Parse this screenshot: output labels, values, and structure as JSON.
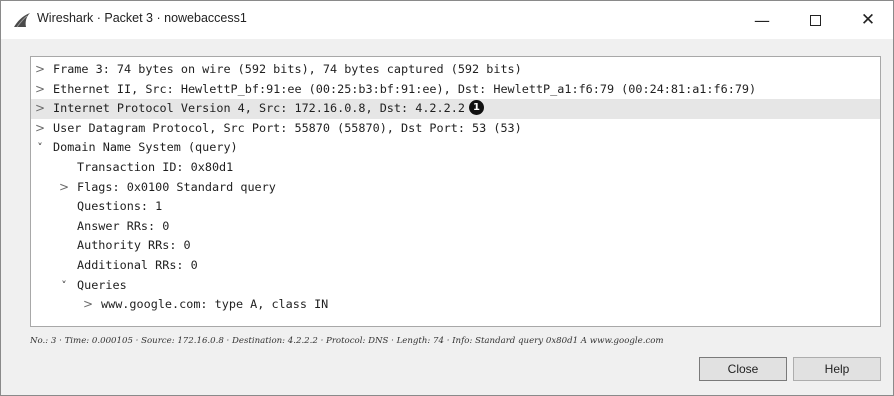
{
  "window": {
    "title": "Wireshark · Packet 3 · nowebaccess1",
    "minimize_glyph": "—",
    "close_glyph": "✕"
  },
  "tree": {
    "rows": [
      {
        "text": "Frame 3: 74 bytes on wire (592 bits), 74 bytes captured (592 bits)",
        "expander": ">"
      },
      {
        "text": "Ethernet II, Src: HewlettP_bf:91:ee (00:25:b3:bf:91:ee), Dst: HewlettP_a1:f6:79 (00:24:81:a1:f6:79)",
        "expander": ">"
      },
      {
        "text": "Internet Protocol Version 4, Src: 172.16.0.8, Dst: 4.2.2.2",
        "expander": ">",
        "callout": "1"
      },
      {
        "text": "User Datagram Protocol, Src Port: 55870 (55870), Dst Port: 53 (53)",
        "expander": ">"
      },
      {
        "text": "Domain Name System (query)",
        "expander": "˅"
      },
      {
        "text": "Transaction ID: 0x80d1"
      },
      {
        "text": "Flags: 0x0100 Standard query",
        "expander": ">"
      },
      {
        "text": "Questions: 1"
      },
      {
        "text": "Answer RRs: 0"
      },
      {
        "text": "Authority RRs: 0"
      },
      {
        "text": "Additional RRs: 0"
      },
      {
        "text": "Queries",
        "expander": "˅"
      },
      {
        "text": "www.google.com: type A, class IN",
        "expander": ">"
      }
    ]
  },
  "status": {
    "text": "No.: 3 · Time: 0.000105 · Source: 172.16.0.8 · Destination: 4.2.2.2 · Protocol: DNS · Length: 74 · Info: Standard query 0x80d1 A www.google.com"
  },
  "buttons": {
    "close": "Close",
    "help": "Help"
  },
  "colors": {
    "selected_row": "#e6e6e6",
    "tree_background": "#ffffff",
    "dialog_background": "#f0f0f0"
  },
  "icons": {
    "app": "wireshark-fin-icon",
    "callout": "numbered-callout-icon"
  }
}
